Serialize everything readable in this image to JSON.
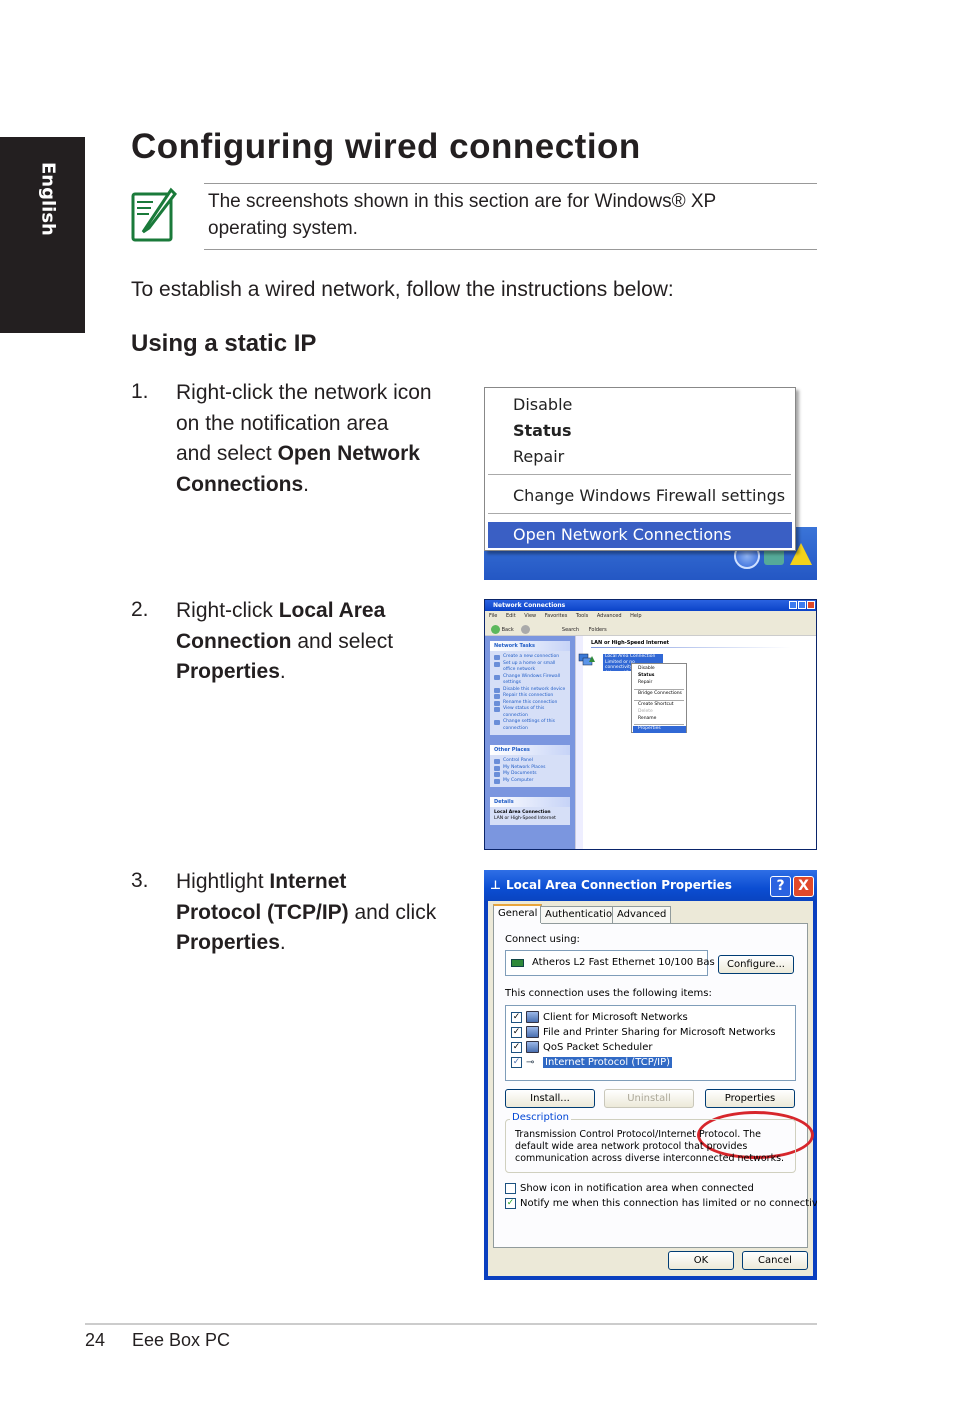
{
  "side_tab": {
    "label": "English"
  },
  "page": {
    "title": "Configuring wired connection",
    "note": {
      "icon": "note-pencil-icon",
      "line1": "The screenshots shown in this section are for Windows® XP",
      "line2": "operating system."
    },
    "intro": "To establish a wired network, follow the instructions below:",
    "subheading": "Using a static IP",
    "steps": [
      {
        "number": "1.",
        "line1": "Right-click the network icon",
        "line2": "on the notification area",
        "line3_prefix": "and select ",
        "line3_bold": "Open Network",
        "line4_bold": "Connections",
        "line4_suffix": "."
      },
      {
        "number": "2.",
        "line1_prefix": "Right-click ",
        "line1_bold": "Local Area",
        "line2_bold": "Connection",
        "line2_suffix": " and select",
        "line3_bold": "Properties",
        "line3_suffix": "."
      },
      {
        "number": "3.",
        "line1_prefix": "Hightlight ",
        "line1_bold": "Internet",
        "line2_bold": "Protocol (TCP/IP)",
        "line2_suffix": " and click",
        "line3_bold": "Properties",
        "line3_suffix": "."
      }
    ]
  },
  "screenshot1": {
    "menu_items": [
      "Disable",
      "Status",
      "Repair",
      "Change Windows Firewall settings",
      "Open Network Connections"
    ],
    "default_item": "Status",
    "highlighted_item": "Open Network Connections",
    "tray_icons": [
      "show-hidden-icons-chevron",
      "network-icon",
      "security-warning-icon"
    ]
  },
  "screenshot2": {
    "window_title": "Network Connections",
    "menu": [
      "File",
      "Edit",
      "View",
      "Favorites",
      "Tools",
      "Advanced",
      "Help"
    ],
    "toolbar": [
      "Back",
      "Search",
      "Folders"
    ],
    "network_tasks": {
      "header": "Network Tasks",
      "items": [
        "Create a new connection",
        "Set up a home or small office network",
        "Change Windows Firewall settings",
        "Disable this network device",
        "Repair this connection",
        "Rename this connection",
        "View status of this connection",
        "Change settings of this connection"
      ]
    },
    "other_places": {
      "header": "Other Places",
      "items": [
        "Control Panel",
        "My Network Places",
        "My Documents",
        "My Computer"
      ]
    },
    "details": {
      "header": "Details",
      "name": "Local Area Connection",
      "type": "LAN or High-Speed Internet"
    },
    "group_header": "LAN or High-Speed Internet",
    "connection_label": [
      "Local Area Connection",
      "Limited or no connectivity",
      "Atheros L2 Fa..."
    ],
    "context_menu": [
      "Disable",
      "Status",
      "Repair",
      "Bridge Connections",
      "Create Shortcut",
      "Delete",
      "Rename",
      "Properties"
    ],
    "context_highlighted": "Properties"
  },
  "screenshot3": {
    "title": "Local Area Connection Properties",
    "help_btn": "?",
    "close_btn": "X",
    "tabs": [
      "General",
      "Authentication",
      "Advanced"
    ],
    "active_tab": "General",
    "connect_using_label": "Connect using:",
    "adapter": "Atheros L2 Fast Ethernet 10/100 Bas",
    "configure_btn": "Configure...",
    "items_label": "This connection uses the following items:",
    "items": [
      {
        "label": "Client for Microsoft Networks",
        "checked": true
      },
      {
        "label": "File and Printer Sharing for Microsoft Networks",
        "checked": true
      },
      {
        "label": "QoS Packet Scheduler",
        "checked": true
      },
      {
        "label": "Internet Protocol (TCP/IP)",
        "checked": true,
        "selected": true
      }
    ],
    "install_btn": "Install...",
    "uninstall_btn": "Uninstall",
    "properties_btn": "Properties",
    "description_legend": "Description",
    "description": "Transmission Control Protocol/Internet Protocol. The default wide area network protocol that provides communication across diverse interconnected networks.",
    "show_icon_label": "Show icon in notification area when connected",
    "show_icon_checked": false,
    "notify_label": "Notify me when this connection has limited or no connectivity",
    "notify_checked": true,
    "ok_btn": "OK",
    "cancel_btn": "Cancel",
    "highlight_color": "#d7262c"
  },
  "footer": {
    "page_number": "24",
    "product": "Eee Box PC"
  }
}
